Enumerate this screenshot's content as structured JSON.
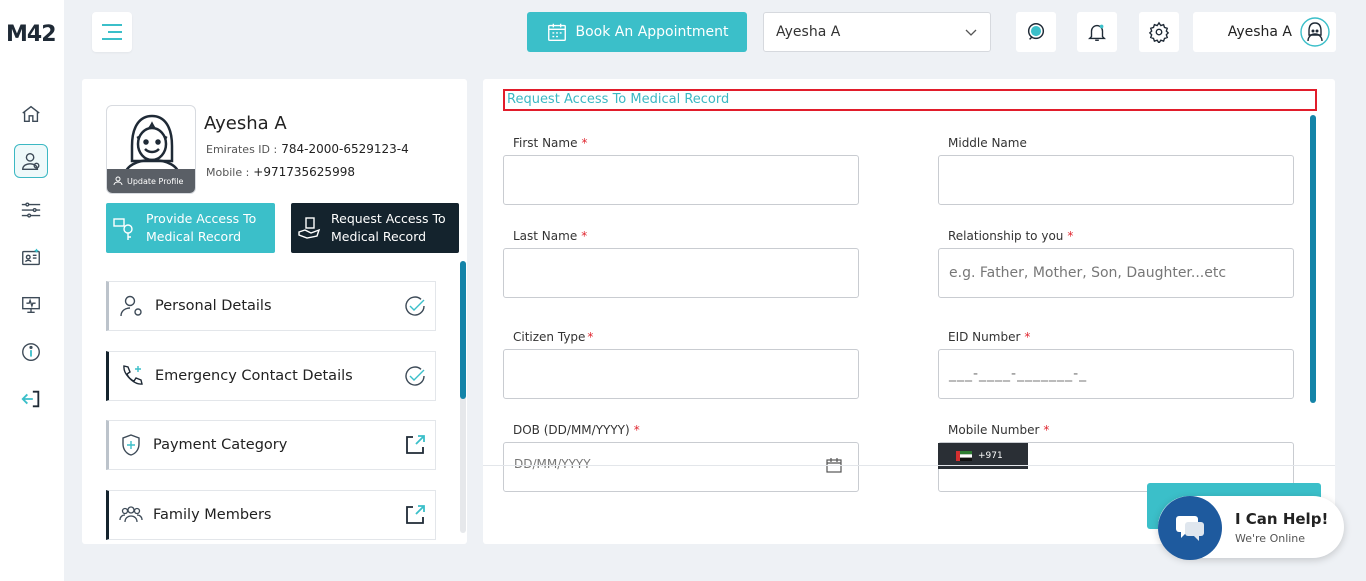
{
  "app": {
    "logo": "M42"
  },
  "header": {
    "book_label": "Book An Appointment",
    "patient_select": "Ayesha A",
    "user_name": "Ayesha A"
  },
  "sidebar": {
    "icons": [
      "home-icon",
      "user-profile-icon",
      "filters-icon",
      "appointments-icon",
      "monitor-icon",
      "info-icon",
      "logout-icon"
    ]
  },
  "profile": {
    "name": "Ayesha A",
    "eid_label": "Emirates ID :",
    "eid_value": "784-2000-6529123-4",
    "mobile_label": "Mobile :",
    "mobile_value": "+971735625998",
    "update_label": "Update Profile",
    "provide_access": "Provide Access To Medical Record",
    "request_access": "Request Access To Medical Record",
    "menu": [
      {
        "label": "Personal Details"
      },
      {
        "label": "Emergency Contact Details"
      },
      {
        "label": "Payment Category"
      },
      {
        "label": "Family Members"
      }
    ]
  },
  "form": {
    "title": "Request Access To Medical Record",
    "first_name": {
      "label": "First Name",
      "value": ""
    },
    "middle_name": {
      "label": "Middle Name",
      "value": ""
    },
    "last_name": {
      "label": "Last Name",
      "value": ""
    },
    "relationship": {
      "label": "Relationship to you",
      "placeholder": "e.g. Father, Mother, Son, Daughter...etc"
    },
    "citizen_type": {
      "label": "Citizen Type",
      "value": ""
    },
    "eid_number": {
      "label": "EID Number",
      "placeholder": "___-____-_______-_"
    },
    "dob": {
      "label": "DOB (DD/MM/YYYY)",
      "placeholder": "DD/MM/YYYY"
    },
    "mobile_number": {
      "label": "Mobile Number",
      "code": "+971"
    },
    "required_mark": "*"
  },
  "chat": {
    "title": "I Can Help!",
    "subtitle": "We're Online"
  },
  "colors": {
    "accent": "#3bbfc9",
    "dark": "#14232d",
    "required": "#e0262f",
    "highlight_border": "#e11d2b"
  }
}
